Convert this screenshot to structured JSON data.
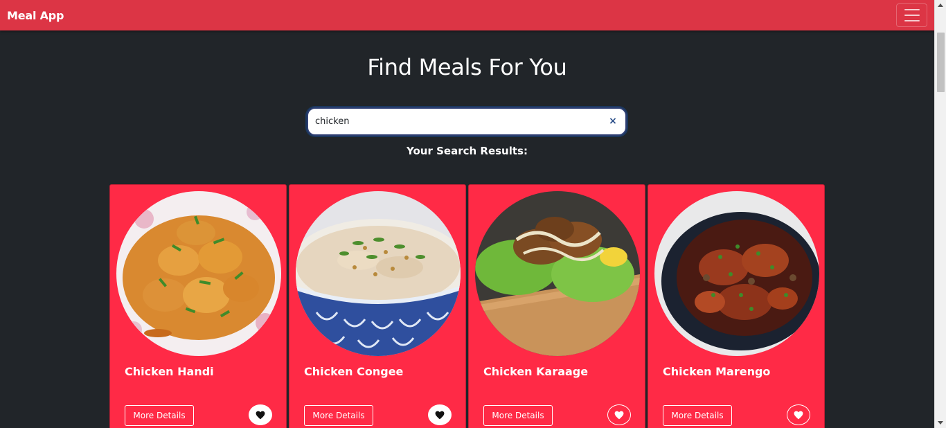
{
  "navbar": {
    "brand": "Meal App"
  },
  "heading": {
    "title": "Find Meals For You"
  },
  "search": {
    "value": "chicken",
    "clear_glyph": "×"
  },
  "results": {
    "label": "Your Search Results:"
  },
  "cards": [
    {
      "title": "Chicken Handi",
      "button": "More Details",
      "favorite": true
    },
    {
      "title": "Chicken Congee",
      "button": "More Details",
      "favorite": true
    },
    {
      "title": "Chicken Karaage",
      "button": "More Details",
      "favorite": false
    },
    {
      "title": "Chicken Marengo",
      "button": "More Details",
      "favorite": false
    }
  ],
  "colors": {
    "navbar": "#dc3545",
    "background": "#212529",
    "card": "#ff2a46"
  }
}
